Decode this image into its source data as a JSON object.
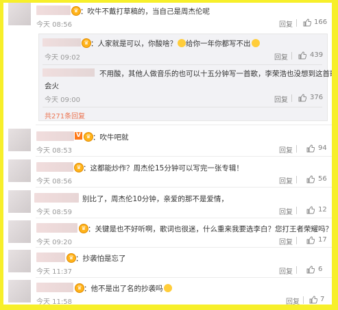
{
  "comments": [
    {
      "text": "：吹牛不戴打草稿的，当自己是周杰伦呢",
      "time": "今天 08:56",
      "reply": "回复",
      "likes": "166"
    },
    {
      "text": "：吹牛吧就",
      "time": "今天 08:53",
      "reply": "回复",
      "likes": "94"
    },
    {
      "text": "：这都能炒作？周杰伦15分钟可以写完一张专辑！",
      "time": "今天 08:56",
      "reply": "回复",
      "likes": "56"
    },
    {
      "text": "别比了，周杰伦10分钟，亲爱的那不是爱情，",
      "time": "今天 08:59",
      "reply": "回复",
      "likes": "12"
    },
    {
      "text": "：关键是也不好听啊，歌词也很迷，什么重来我要选李白？您打王者荣耀吗？",
      "time": "今天 09:20",
      "reply": "回复",
      "likes": "17"
    },
    {
      "text": "：抄袭怕是忘了",
      "time": "今天 11:37",
      "reply": "回复",
      "likes": "6"
    },
    {
      "text": "：他不是出了名的抄袭吗",
      "time": "今天 11:58",
      "reply": "回复",
      "likes": "7"
    }
  ],
  "replies": [
    {
      "text": "：人家就是可以，你酸啥？",
      "text2": "给你一年你都写不出",
      "time": "今天 09:02",
      "reply": "回复",
      "likes": "439"
    },
    {
      "text": "不用酸，其他人做音乐的也可以十五分钟写一首歌，李荣浩也没想到这首歌",
      "text_line2": "会火",
      "time": "今天 09:00",
      "reply": "回复",
      "likes": "376"
    }
  ],
  "more_replies": "共271条回复",
  "icons": {
    "thumb": "thumbs-up-icon",
    "crown": "crown-icon",
    "vip": "vip-icon",
    "emoji": "emoji-icon"
  },
  "colors": {
    "background": "#f7ef2a",
    "link": "#eb7350"
  }
}
